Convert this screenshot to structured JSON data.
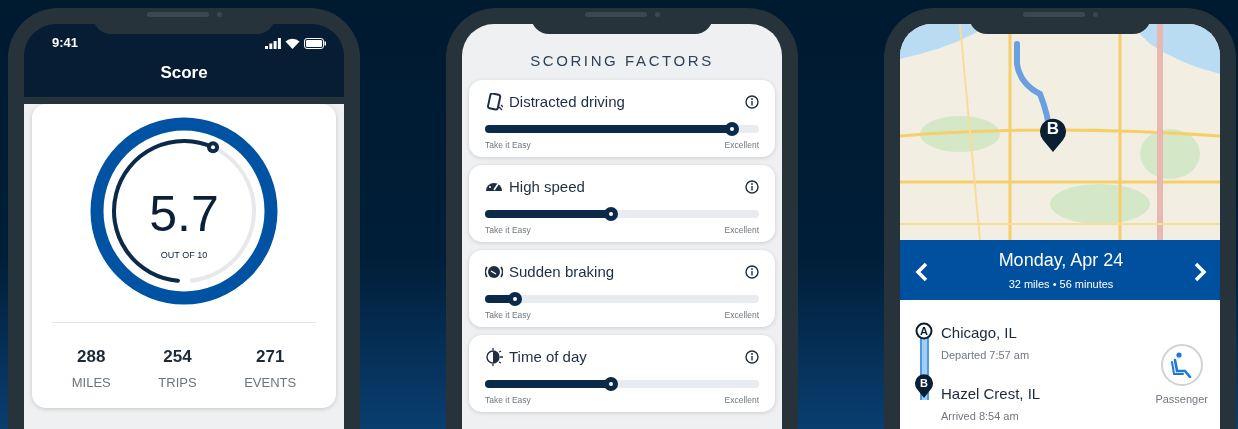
{
  "phones": [
    {
      "kind": "score",
      "status_bar": {
        "time": "9:41"
      },
      "title": "Score",
      "score": {
        "value": "5.7",
        "caption": "OUT OF 10"
      },
      "stats": [
        {
          "value": "288",
          "label": "MILES"
        },
        {
          "value": "254",
          "label": "TRIPS"
        },
        {
          "value": "271",
          "label": "EVENTS"
        }
      ]
    },
    {
      "kind": "factors",
      "title": "SCORING FACTORS",
      "factors": [
        {
          "kind": "distraction",
          "name": "Distracted driving",
          "level": 0.9,
          "low_label": "Take it Easy",
          "high_label": "Excellent"
        },
        {
          "kind": "speed",
          "name": "High speed",
          "level": 0.46,
          "low_label": "Take it Easy",
          "high_label": "Excellent"
        },
        {
          "kind": "braking",
          "name": "Sudden braking",
          "level": 0.11,
          "low_label": "Take it Easy",
          "high_label": "Excellent"
        },
        {
          "kind": "time",
          "name": "Time of day",
          "level": 0.46,
          "low_label": "Take it Easy",
          "high_label": "Excellent"
        }
      ]
    },
    {
      "kind": "trip",
      "map_pin": "B",
      "date": "Monday, Apr 24",
      "summary": "32 miles • 56 minutes",
      "stops": [
        {
          "kind": "start",
          "marker": "A",
          "place": "Chicago, IL",
          "time": "Departed 7:57 am"
        },
        {
          "kind": "end",
          "marker": "B",
          "place": "Hazel Crest, IL",
          "time": "Arrived 8:54 am"
        }
      ],
      "role": "Passenger"
    }
  ]
}
